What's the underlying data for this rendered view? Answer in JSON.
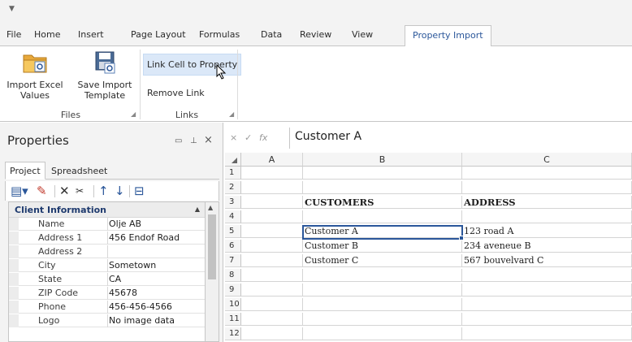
{
  "ribbon_tabs": [
    "File",
    "Home",
    "Insert",
    "Page Layout",
    "Formulas",
    "Data",
    "Review",
    "View",
    "Property Import"
  ],
  "active_tab": "Property Import",
  "ribbon": {
    "import_excel_values": "Import Excel Values",
    "import_excel_line1": "Import Excel",
    "import_excel_line2": "Values",
    "save_import_line1": "Save Import",
    "save_import_line2": "Template",
    "files_group": "Files",
    "link_cell": "Link Cell to Property",
    "remove_link": "Remove Link",
    "links_group": "Links"
  },
  "properties_panel": {
    "title": "Properties",
    "tabs": [
      "Project",
      "Spreadsheet"
    ],
    "category": "Client Information",
    "rows": [
      {
        "name": "Name",
        "value": "Olje AB"
      },
      {
        "name": "Address 1",
        "value": "456 Endof Road"
      },
      {
        "name": "Address 2",
        "value": ""
      },
      {
        "name": "City",
        "value": "Sometown"
      },
      {
        "name": "State",
        "value": "CA"
      },
      {
        "name": "ZIP Code",
        "value": "45678"
      },
      {
        "name": "Phone",
        "value": "456-456-4566"
      },
      {
        "name": "Logo",
        "value": "No image data"
      }
    ]
  },
  "formula_bar": {
    "cancel": "×",
    "enter": "✓",
    "fx": "fx",
    "content": "Customer A"
  },
  "sheet": {
    "columns": [
      "A",
      "B",
      "C"
    ],
    "rows": [
      "1",
      "2",
      "3",
      "4",
      "5",
      "6",
      "7",
      "8",
      "9",
      "10",
      "11",
      "12"
    ],
    "cells": {
      "B3": "CUSTOMERS",
      "C3": "ADDRESS",
      "B5": "Customer A",
      "C5": "123 road A",
      "B6": "Customer B",
      "C6": "234 aveneue B",
      "B7": "Customer C",
      "C7": "567 bouvelvard C"
    },
    "selected_cell": "B5"
  },
  "icons": {
    "qat": "customize-arrow-icon",
    "import": "folder-import-icon",
    "save_template": "floppy-save-icon",
    "launcher": "dialog-launcher-icon",
    "cursor": "mouse-cursor-icon"
  },
  "colors": {
    "accent": "#2b579a",
    "ribbon_bg": "#f3f3f3",
    "hot_button": "#dbe8f8"
  }
}
